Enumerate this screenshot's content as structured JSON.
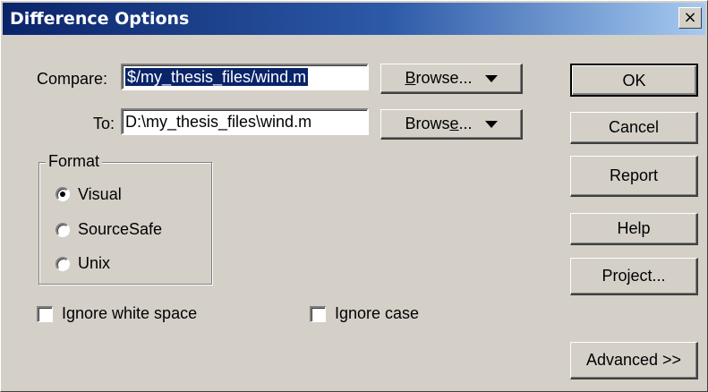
{
  "window": {
    "title": "Difference Options",
    "close_label": "×"
  },
  "compare": {
    "label": "Compare:",
    "value": "$/my_thesis_files/wind.m",
    "browse_pre": "",
    "browse_ul": "B",
    "browse_post": "rowse..."
  },
  "to": {
    "label": "To:",
    "value": "D:\\my_thesis_files\\wind.m",
    "browse_pre": "Brows",
    "browse_ul": "e",
    "browse_post": "..."
  },
  "format": {
    "label": "Format",
    "options": [
      {
        "label": "Visual",
        "selected": true
      },
      {
        "label": "SourceSafe",
        "selected": false
      },
      {
        "label": "Unix",
        "selected": false
      }
    ]
  },
  "options": {
    "ignore_white_space": "Ignore white space",
    "ignore_case": "Ignore case"
  },
  "buttons": {
    "ok": "OK",
    "cancel": "Cancel",
    "report": "Report",
    "help": "Help",
    "project": "Project...",
    "advanced": "Advanced >>"
  }
}
